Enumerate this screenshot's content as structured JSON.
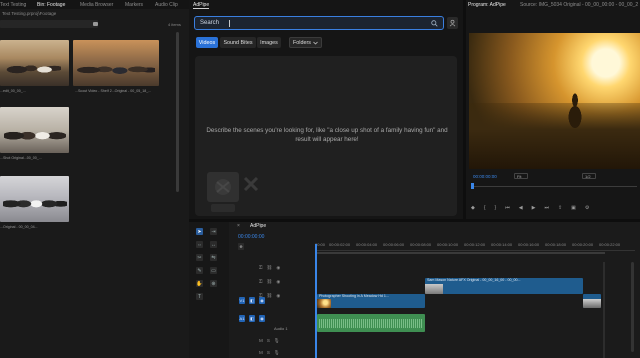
{
  "project_panel": {
    "tabs": [
      "Text Testing",
      "Bin: Footage",
      "Media Browser",
      "Markers",
      "Audio Clip"
    ],
    "path": "Text Testing.prproj\\Footage",
    "item_count": "4 items",
    "clips": [
      {
        "label": "...edit_00_00_..."
      },
      {
        "label": "...Scout Video - Shelf 2...Original - 00_05_18_..."
      },
      {
        "label": "...Shot Original...00_00_..."
      },
      {
        "label": "...Original - 00_00_04..."
      }
    ]
  },
  "adpipe": {
    "tab": "AdPipe",
    "search_placeholder": "Search",
    "tabs": [
      "Videos",
      "Sound Bites",
      "Images"
    ],
    "folders_label": "Folders",
    "empty_message": "Describe the scenes you're looking for, like \"a close up shot of a family having fun\" and result will appear here!"
  },
  "program": {
    "tab": "Program: AdPipe",
    "source_tab": "Source: IMG_5034 Original - 00_00_00:00 - 00_00_23:18",
    "timecode": "00:00:00:00",
    "fit": "Fit",
    "quality": "1/2"
  },
  "timeline": {
    "tab": "AdPipe",
    "timecode": "00:00:00:00",
    "ruler": [
      "00:00",
      "00:00:02:00",
      "00:00:04:00",
      "00:00:06:00",
      "00:00:08:00",
      "00:00:10:00",
      "00:00:12:00",
      "00:00:14:00",
      "00:00:16:00",
      "00:00:18:00",
      "00:00:20:00",
      "00:00:22:00"
    ],
    "clip1": "Photographer Shooting in A Meadow Hd 1...",
    "clip2": "Sam Mason Nature AFX Original - 00_00_16_00 - 00_00...",
    "audio_label": "Audio 1"
  },
  "colors": {
    "accent": "#2a72d8",
    "video_clip": "#1f5c8e",
    "audio_clip": "#3f8f52"
  }
}
